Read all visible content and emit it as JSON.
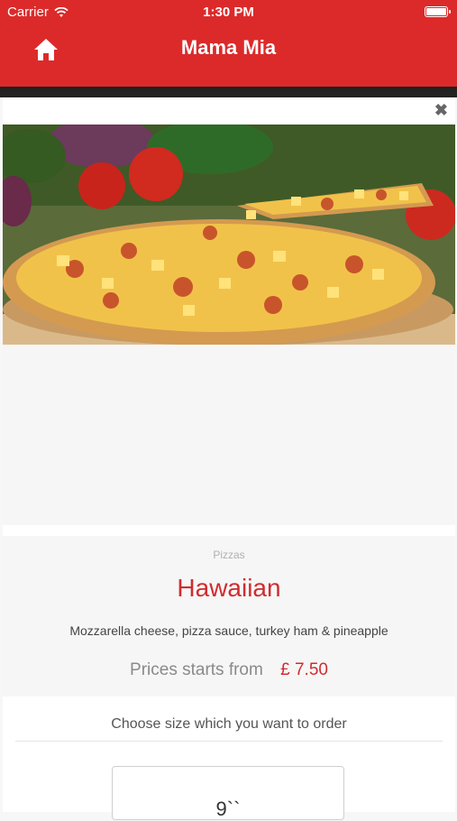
{
  "status": {
    "carrier": "Carrier",
    "time": "1:30 PM"
  },
  "nav": {
    "title": "Mama Mia"
  },
  "item": {
    "category": "Pizzas",
    "name": "Hawaiian",
    "description": "Mozzarella cheese, pizza sauce, turkey ham & pineapple",
    "price_label": "Prices starts from",
    "price": "£ 7.50"
  },
  "order": {
    "prompt": "Choose size which you want to order",
    "sizes": [
      "9``"
    ]
  },
  "colors": {
    "brand": "#dc2a2a",
    "accent_text": "#d02c2f"
  },
  "icons": {
    "home": "home-icon",
    "close": "close-icon",
    "wifi": "wifi-icon",
    "battery": "battery-icon"
  }
}
